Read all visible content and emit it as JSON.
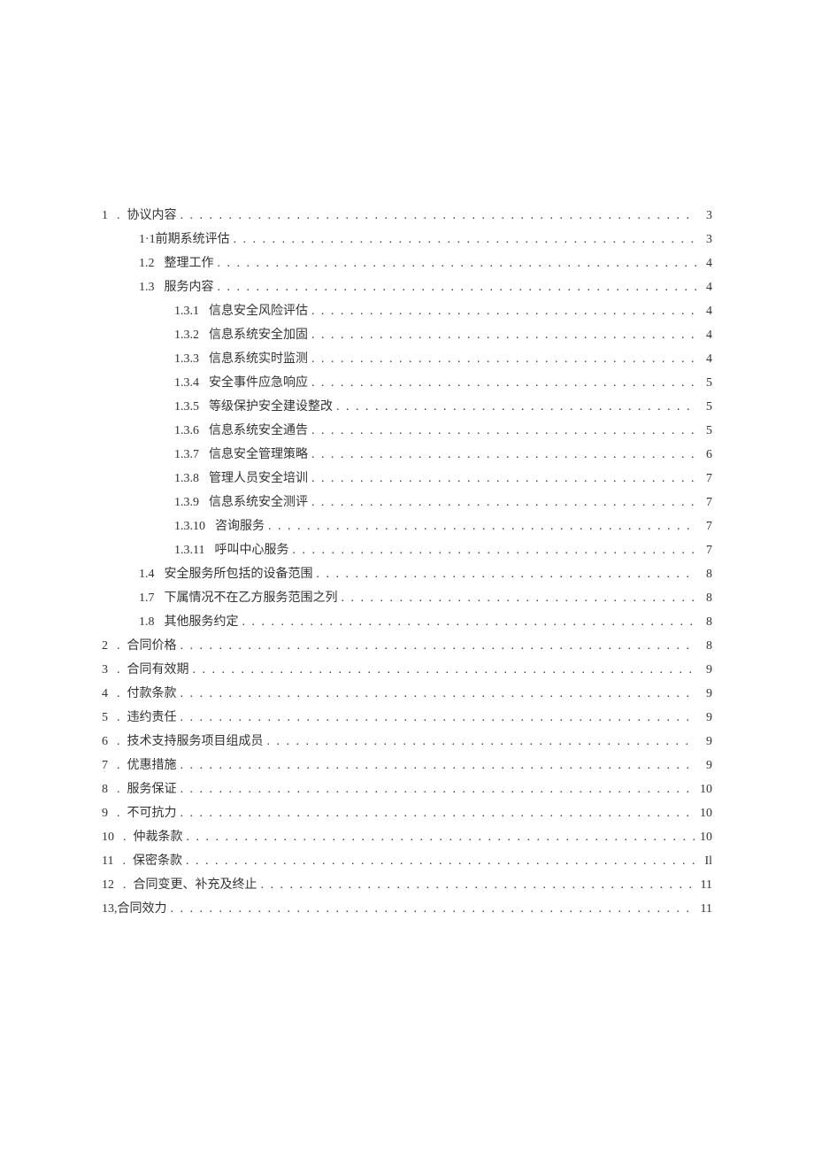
{
  "toc": [
    {
      "indent": 0,
      "num": "1",
      "sep": " .",
      "title": "协议内容",
      "page": "3",
      "pgap": ""
    },
    {
      "indent": 1,
      "num": "",
      "sep": "",
      "title": "1·1前期系统评估",
      "page": "3",
      "pgap": ""
    },
    {
      "indent": 1,
      "num": "1.2",
      "sep": "",
      "title": "整理工作",
      "page": "4",
      "pgap": ""
    },
    {
      "indent": 1,
      "num": "1.3",
      "sep": "",
      "title": "服务内容",
      "page": "4",
      "pgap": ""
    },
    {
      "indent": 2,
      "num": "1.3.1",
      "sep": "",
      "title": "信息安全风险评估",
      "page": "4",
      "pgap": ""
    },
    {
      "indent": 2,
      "num": "1.3.2",
      "sep": "",
      "title": "信息系统安全加固",
      "page": "4",
      "pgap": " "
    },
    {
      "indent": 2,
      "num": "1.3.3",
      "sep": "",
      "title": "信息系统实时监测",
      "page": "4",
      "pgap": " "
    },
    {
      "indent": 2,
      "num": "1.3.4",
      "sep": "",
      "title": "安全事件应急响应",
      "page": "5",
      "pgap": " "
    },
    {
      "indent": 2,
      "num": "1.3.5",
      "sep": "",
      "title": "等级保护安全建设整改",
      "page": "5",
      "pgap": " "
    },
    {
      "indent": 2,
      "num": "1.3.6",
      "sep": "",
      "title": "信息系统安全通告",
      "page": "5",
      "pgap": " "
    },
    {
      "indent": 2,
      "num": "1.3.7",
      "sep": "",
      "title": "信息安全管理策略",
      "page": "6",
      "pgap": " "
    },
    {
      "indent": 2,
      "num": "1.3.8",
      "sep": "",
      "title": "管理人员安全培训",
      "page": "7",
      "pgap": ""
    },
    {
      "indent": 2,
      "num": "1.3.9",
      "sep": "",
      "title": "信息系统安全测评",
      "page": "7",
      "pgap": ""
    },
    {
      "indent": 2,
      "num": "1.3.10",
      "sep": "",
      "title": "咨询服务",
      "page": "7",
      "pgap": ""
    },
    {
      "indent": 2,
      "num": "1.3.11",
      "sep": "",
      "title": "呼叫中心服务",
      "page": "7",
      "pgap": ""
    },
    {
      "indent": 1,
      "num": "1.4",
      "sep": "",
      "title": "安全服务所包括的设备范围",
      "page": "8",
      "pgap": ""
    },
    {
      "indent": 1,
      "num": "1.7",
      "sep": "",
      "title": "下属情况不在乙方服务范围之列",
      "page": "8",
      "pgap": ""
    },
    {
      "indent": 1,
      "num": "1.8",
      "sep": "",
      "title": "其他服务约定",
      "page": "8",
      "pgap": ""
    },
    {
      "indent": 0,
      "num": "2",
      "sep": " .",
      "title": "合同价格",
      "page": "8",
      "pgap": ""
    },
    {
      "indent": 0,
      "num": "3",
      "sep": " .",
      "title": "合同有效期",
      "page": "9",
      "pgap": ""
    },
    {
      "indent": 0,
      "num": "4",
      "sep": " .",
      "title": "付款条款",
      "page": "9",
      "pgap": ""
    },
    {
      "indent": 0,
      "num": "5",
      "sep": " .",
      "title": "违约责任",
      "page": "9",
      "pgap": ""
    },
    {
      "indent": 0,
      "num": "6",
      "sep": " .",
      "title": "技术支持服务项目组成员",
      "page": "9",
      "pgap": " "
    },
    {
      "indent": 0,
      "num": "7",
      "sep": " .",
      "title": "优惠措施",
      "page": "9",
      "pgap": ""
    },
    {
      "indent": 0,
      "num": "8",
      "sep": " .",
      "title": "服务保证",
      "page": "10",
      "pgap": ""
    },
    {
      "indent": 0,
      "num": "9",
      "sep": " .",
      "title": "不可抗力",
      "page": "10",
      "pgap": ""
    },
    {
      "indent": 0,
      "num": "10",
      "sep": " .",
      "title": "仲裁条款",
      "page": "10",
      "pgap": ""
    },
    {
      "indent": 0,
      "num": "11",
      "sep": " .",
      "title": "保密条款",
      "page": "Il",
      "pgap": ""
    },
    {
      "indent": 0,
      "num": "12",
      "sep": " .",
      "title": "合同变更、补充及终止",
      "page": "11",
      "pgap": ""
    },
    {
      "indent": 0,
      "num": "",
      "sep": "",
      "title": "13,合同效力",
      "page": "11",
      "pgap": ""
    }
  ],
  "dots": ". . . . . . . . . . . . . . . . . . . . . . . . . . . . . . . . . . . . . . . . . . . . . . . . . . . . . . . . . . . . . . . . . . . . . . . . . . . . . . . . . . . . . . . . . . . . . . . . . . . . . ."
}
